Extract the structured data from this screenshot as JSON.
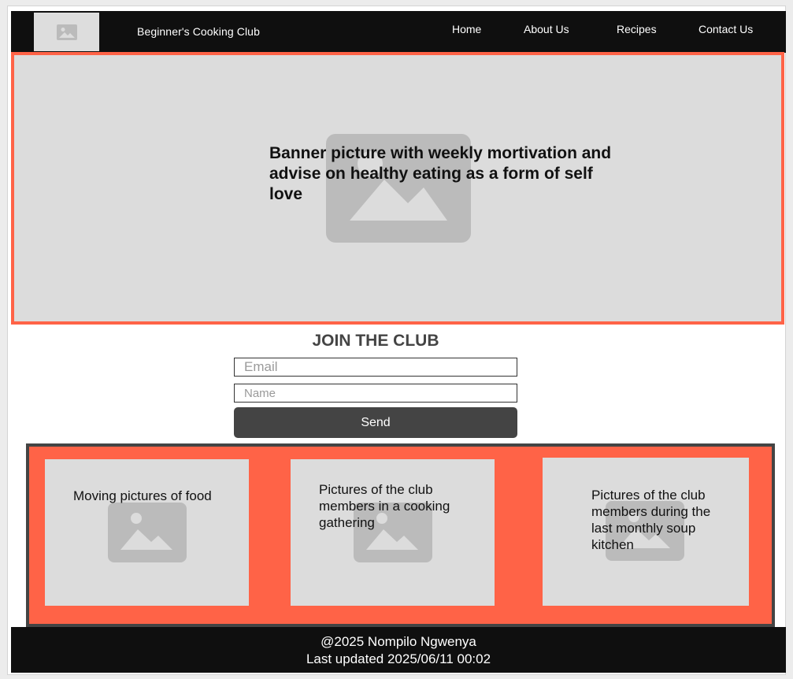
{
  "header": {
    "site_title": "Beginner's Cooking Club",
    "logo_icon": "image-placeholder-icon",
    "nav": {
      "home": "Home",
      "about": "About Us",
      "recipes": "Recipes",
      "contact": "Contact Us"
    }
  },
  "banner": {
    "text": "Banner picture with weekly mortivation and advise on healthy eating as a form of self love",
    "icon": "image-placeholder-icon"
  },
  "join": {
    "title": "JOIN THE CLUB",
    "email_placeholder": "Email",
    "name_placeholder": "Name",
    "send_label": "Send"
  },
  "gallery": {
    "cards": [
      {
        "text": "Moving pictures of food",
        "icon": "image-placeholder-icon"
      },
      {
        "text": "Pictures of the club members in a cooking gathering",
        "icon": "image-placeholder-icon"
      },
      {
        "text": "Pictures of the club members during the last monthly soup kitchen",
        "icon": "image-placeholder-icon"
      }
    ]
  },
  "footer": {
    "copyright": "@2025 Nompilo Ngwenya",
    "last_updated": "Last updated 2025/06/11 00:02"
  },
  "colors": {
    "accent": "#ff6347",
    "header_bg": "#0f0f0f",
    "placeholder_bg": "#dcdcdc",
    "button_bg": "#444444"
  }
}
